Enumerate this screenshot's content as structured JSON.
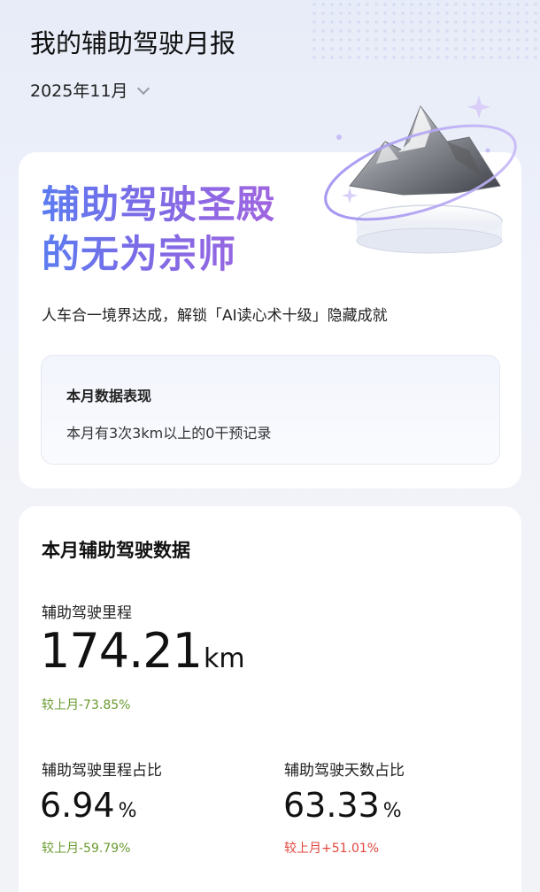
{
  "header": {
    "title": "我的辅助驾驶月报",
    "month": "2025年11月"
  },
  "achievement": {
    "title_line1": "辅助驾驶圣殿",
    "title_line2": "的无为宗师",
    "subtitle": "人车合一境界达成，解锁「AI读心术十级」隐藏成就",
    "performance_title": "本月数据表现",
    "performance_text": "本月有3次3km以上的0干预记录"
  },
  "stats": {
    "section_title": "本月辅助驾驶数据",
    "mileage": {
      "label": "辅助驾驶里程",
      "value": "174.21",
      "unit": "km",
      "delta": "较上月-73.85%",
      "delta_color": "#6a9a2f"
    },
    "mileage_ratio": {
      "label": "辅助驾驶里程占比",
      "value": "6.94",
      "unit": "%",
      "delta": "较上月-59.79%",
      "delta_color": "#6a9a2f"
    },
    "days_ratio": {
      "label": "辅助驾驶天数占比",
      "value": "63.33",
      "unit": "%",
      "delta": "较上月+51.01%",
      "delta_color": "#e2463d"
    }
  },
  "icons": {
    "month_dropdown": "chevron-down-icon",
    "illustration": "mountain-illustration"
  }
}
